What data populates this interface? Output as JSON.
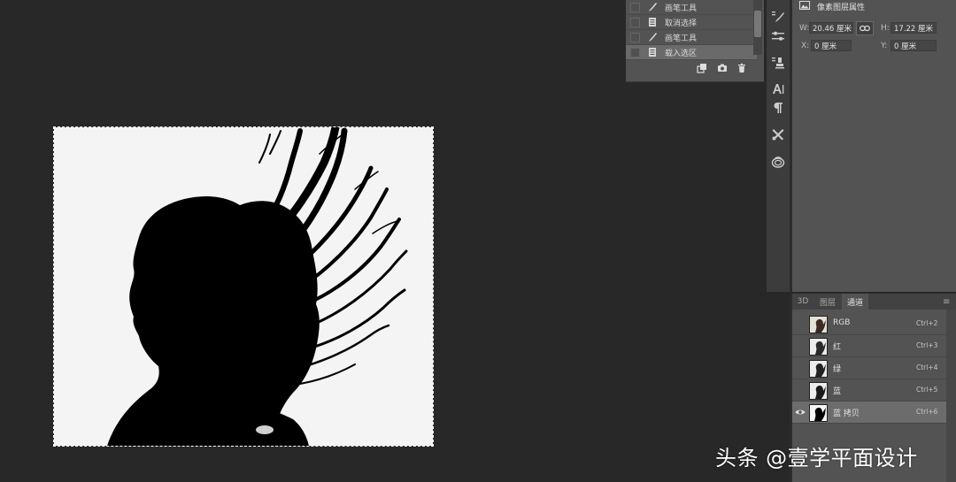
{
  "history": {
    "items": [
      {
        "label": "画笔工具",
        "icon": "brush-icon"
      },
      {
        "label": "取消选择",
        "icon": "document-icon"
      },
      {
        "label": "画笔工具",
        "icon": "brush-icon"
      },
      {
        "label": "载入选区",
        "icon": "document-icon",
        "active": true
      }
    ],
    "bottom_icons": [
      "new-document-from-state-icon",
      "camera-icon",
      "trash-icon"
    ]
  },
  "toolstrip": {
    "icons": [
      "brush-settings-icon",
      "adjustments-icon",
      "clone-source-icon",
      "character-icon",
      "paragraph-icon",
      "tools-icon",
      "libraries-icon"
    ]
  },
  "properties": {
    "title": "像素图层属性",
    "w_label": "W:",
    "w_value": "20.46 厘米",
    "h_label": "H:",
    "h_value": "17.22 厘米",
    "x_label": "X:",
    "x_value": "0 厘米",
    "y_label": "Y:",
    "y_value": "0 厘米"
  },
  "channels_panel": {
    "tabs": [
      {
        "label": "3D"
      },
      {
        "label": "图层"
      },
      {
        "label": "通道",
        "active": true
      }
    ],
    "channels": [
      {
        "name": "RGB",
        "shortcut": "Ctrl+2",
        "visible": false
      },
      {
        "name": "红",
        "shortcut": "Ctrl+3",
        "visible": false
      },
      {
        "name": "绿",
        "shortcut": "Ctrl+4",
        "visible": false
      },
      {
        "name": "蓝",
        "shortcut": "Ctrl+5",
        "visible": false
      },
      {
        "name": "蓝 拷贝",
        "shortcut": "Ctrl+6",
        "visible": true,
        "active": true
      }
    ]
  },
  "watermark": "头条 @壹学平面设计",
  "colors": {
    "workspace": "#282828",
    "panel": "#535353",
    "selected_row": "#6c6c6c"
  }
}
